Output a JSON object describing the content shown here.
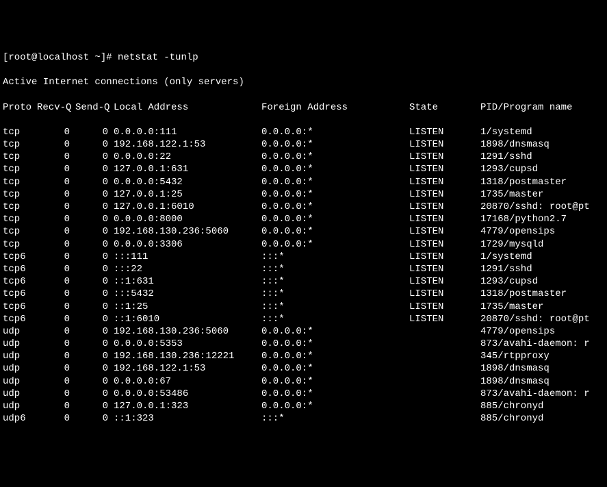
{
  "prompt": {
    "prefix": "[root@localhost ~]# ",
    "command": "netstat -tunlp"
  },
  "header_line": "Active Internet connections (only servers)",
  "columns": {
    "proto": "Proto",
    "recvq": "Recv-Q",
    "sendq": "Send-Q",
    "local": "Local Address",
    "foreign": "Foreign Address",
    "state": "State",
    "prog": "PID/Program name"
  },
  "rows": [
    {
      "proto": "tcp",
      "recvq": "0",
      "sendq": "0",
      "local": "0.0.0.0:111",
      "foreign": "0.0.0.0:*",
      "state": "LISTEN",
      "prog": "1/systemd"
    },
    {
      "proto": "tcp",
      "recvq": "0",
      "sendq": "0",
      "local": "192.168.122.1:53",
      "foreign": "0.0.0.0:*",
      "state": "LISTEN",
      "prog": "1898/dnsmasq"
    },
    {
      "proto": "tcp",
      "recvq": "0",
      "sendq": "0",
      "local": "0.0.0.0:22",
      "foreign": "0.0.0.0:*",
      "state": "LISTEN",
      "prog": "1291/sshd"
    },
    {
      "proto": "tcp",
      "recvq": "0",
      "sendq": "0",
      "local": "127.0.0.1:631",
      "foreign": "0.0.0.0:*",
      "state": "LISTEN",
      "prog": "1293/cupsd"
    },
    {
      "proto": "tcp",
      "recvq": "0",
      "sendq": "0",
      "local": "0.0.0.0:5432",
      "foreign": "0.0.0.0:*",
      "state": "LISTEN",
      "prog": "1318/postmaster"
    },
    {
      "proto": "tcp",
      "recvq": "0",
      "sendq": "0",
      "local": "127.0.0.1:25",
      "foreign": "0.0.0.0:*",
      "state": "LISTEN",
      "prog": "1735/master"
    },
    {
      "proto": "tcp",
      "recvq": "0",
      "sendq": "0",
      "local": "127.0.0.1:6010",
      "foreign": "0.0.0.0:*",
      "state": "LISTEN",
      "prog": "20870/sshd: root@pt"
    },
    {
      "proto": "tcp",
      "recvq": "0",
      "sendq": "0",
      "local": "0.0.0.0:8000",
      "foreign": "0.0.0.0:*",
      "state": "LISTEN",
      "prog": "17168/python2.7"
    },
    {
      "proto": "tcp",
      "recvq": "0",
      "sendq": "0",
      "local": "192.168.130.236:5060",
      "foreign": "0.0.0.0:*",
      "state": "LISTEN",
      "prog": "4779/opensips"
    },
    {
      "proto": "tcp",
      "recvq": "0",
      "sendq": "0",
      "local": "0.0.0.0:3306",
      "foreign": "0.0.0.0:*",
      "state": "LISTEN",
      "prog": "1729/mysqld"
    },
    {
      "proto": "tcp6",
      "recvq": "0",
      "sendq": "0",
      "local": ":::111",
      "foreign": ":::*",
      "state": "LISTEN",
      "prog": "1/systemd"
    },
    {
      "proto": "tcp6",
      "recvq": "0",
      "sendq": "0",
      "local": ":::22",
      "foreign": ":::*",
      "state": "LISTEN",
      "prog": "1291/sshd"
    },
    {
      "proto": "tcp6",
      "recvq": "0",
      "sendq": "0",
      "local": "::1:631",
      "foreign": ":::*",
      "state": "LISTEN",
      "prog": "1293/cupsd"
    },
    {
      "proto": "tcp6",
      "recvq": "0",
      "sendq": "0",
      "local": ":::5432",
      "foreign": ":::*",
      "state": "LISTEN",
      "prog": "1318/postmaster"
    },
    {
      "proto": "tcp6",
      "recvq": "0",
      "sendq": "0",
      "local": "::1:25",
      "foreign": ":::*",
      "state": "LISTEN",
      "prog": "1735/master"
    },
    {
      "proto": "tcp6",
      "recvq": "0",
      "sendq": "0",
      "local": "::1:6010",
      "foreign": ":::*",
      "state": "LISTEN",
      "prog": "20870/sshd: root@pt"
    },
    {
      "proto": "udp",
      "recvq": "0",
      "sendq": "0",
      "local": "192.168.130.236:5060",
      "foreign": "0.0.0.0:*",
      "state": "",
      "prog": "4779/opensips"
    },
    {
      "proto": "udp",
      "recvq": "0",
      "sendq": "0",
      "local": "0.0.0.0:5353",
      "foreign": "0.0.0.0:*",
      "state": "",
      "prog": "873/avahi-daemon: r"
    },
    {
      "proto": "udp",
      "recvq": "0",
      "sendq": "0",
      "local": "192.168.130.236:12221",
      "foreign": "0.0.0.0:*",
      "state": "",
      "prog": "345/rtpproxy"
    },
    {
      "proto": "udp",
      "recvq": "0",
      "sendq": "0",
      "local": "192.168.122.1:53",
      "foreign": "0.0.0.0:*",
      "state": "",
      "prog": "1898/dnsmasq"
    },
    {
      "proto": "udp",
      "recvq": "0",
      "sendq": "0",
      "local": "0.0.0.0:67",
      "foreign": "0.0.0.0:*",
      "state": "",
      "prog": "1898/dnsmasq"
    },
    {
      "proto": "udp",
      "recvq": "0",
      "sendq": "0",
      "local": "0.0.0.0:53486",
      "foreign": "0.0.0.0:*",
      "state": "",
      "prog": "873/avahi-daemon: r"
    },
    {
      "proto": "udp",
      "recvq": "0",
      "sendq": "0",
      "local": "127.0.0.1:323",
      "foreign": "0.0.0.0:*",
      "state": "",
      "prog": "885/chronyd"
    },
    {
      "proto": "udp6",
      "recvq": "0",
      "sendq": "0",
      "local": "::1:323",
      "foreign": ":::*",
      "state": "",
      "prog": "885/chronyd"
    }
  ]
}
